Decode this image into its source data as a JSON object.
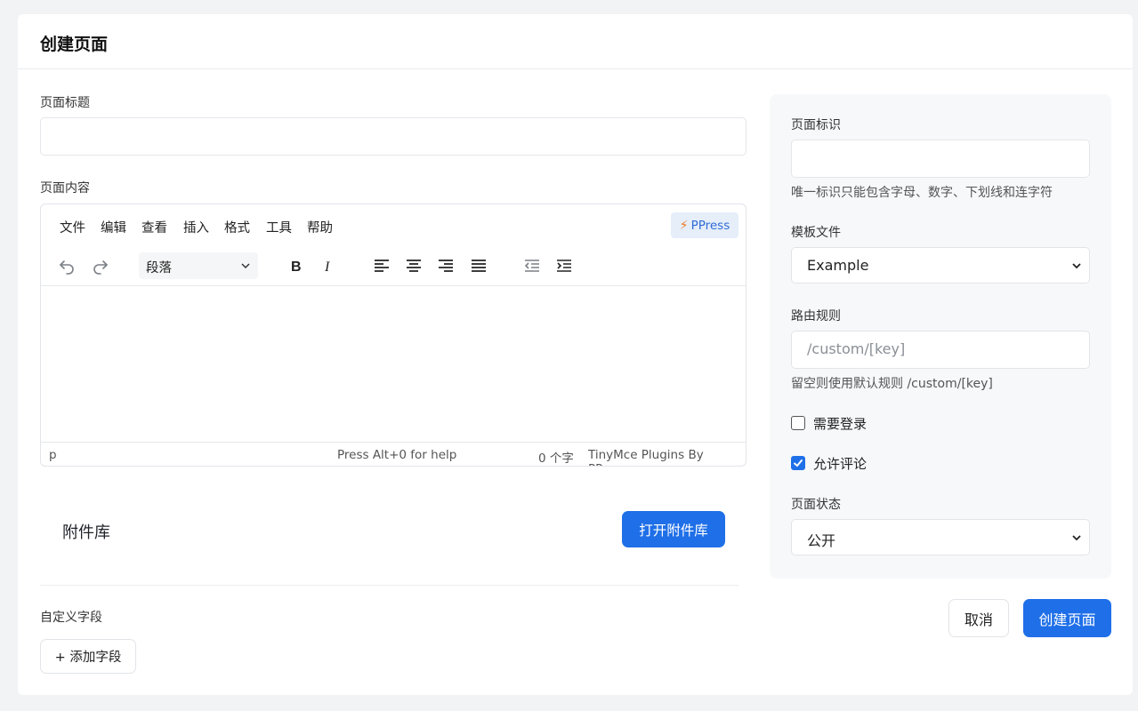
{
  "page": {
    "title": "创建页面"
  },
  "form": {
    "page_title_label": "页面标题",
    "page_title_value": "",
    "page_content_label": "页面内容"
  },
  "editor": {
    "menus": [
      "文件",
      "编辑",
      "查看",
      "插入",
      "格式",
      "工具",
      "帮助"
    ],
    "badge": "PPress",
    "block_format": "段落",
    "status_path": "p",
    "status_help": "Press Alt+0 for help",
    "status_wordcount": "0 个字",
    "status_brand": "TinyMce Plugins By PPress"
  },
  "attachments": {
    "title": "附件库",
    "open_button": "打开附件库"
  },
  "custom_fields": {
    "label": "自定义字段",
    "add_button": "+ 添加字段"
  },
  "sidebar": {
    "slug_label": "页面标识",
    "slug_value": "",
    "slug_hint": "唯一标识只能包含字母、数字、下划线和连字符",
    "template_label": "模板文件",
    "template_value": "Example",
    "route_label": "路由规则",
    "route_placeholder": "/custom/[key]",
    "route_hint": "留空则使用默认规则 /custom/[key]",
    "require_login_label": "需要登录",
    "require_login_checked": false,
    "allow_comments_label": "允许评论",
    "allow_comments_checked": true,
    "status_label": "页面状态",
    "status_value": "公开"
  },
  "actions": {
    "cancel": "取消",
    "create": "创建页面"
  },
  "colors": {
    "primary": "#1f6fe8",
    "badge_bg": "#e5eef9",
    "bolt": "#f07a24"
  }
}
